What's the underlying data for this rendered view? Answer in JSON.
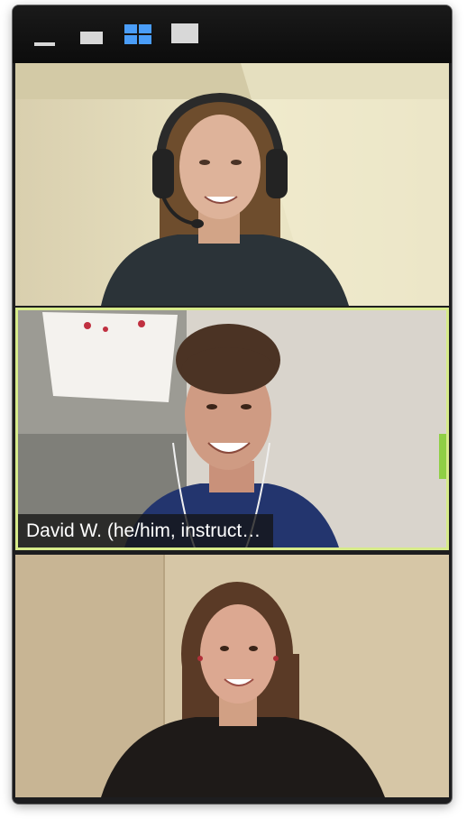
{
  "toolbar": {
    "buttons": [
      {
        "name": "minimize-view-icon",
        "active": false
      },
      {
        "name": "strip-view-icon",
        "active": false
      },
      {
        "name": "gallery-view-icon",
        "active": true
      },
      {
        "name": "speaker-view-icon",
        "active": false
      }
    ],
    "accent_color": "#4a9df8"
  },
  "participants": [
    {
      "name": "",
      "speaking": false
    },
    {
      "name": "David W. (he/him, instruct…",
      "speaking": true
    },
    {
      "name": "",
      "speaking": false
    }
  ],
  "colors": {
    "active_speaker_border": "#d7eb8a",
    "window_background": "#1d1d1f"
  }
}
